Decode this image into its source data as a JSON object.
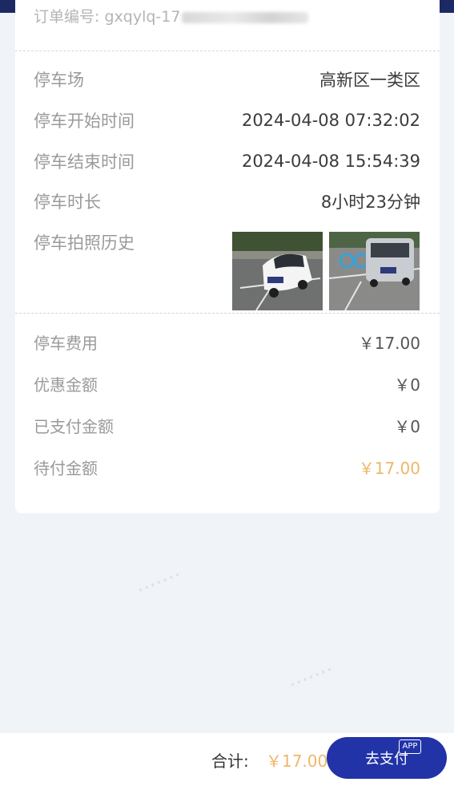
{
  "order": {
    "label": "订单编号:",
    "prefix": "gxqylq-17"
  },
  "details": {
    "parking_lot": {
      "label": "停车场",
      "value": "高新区一类区"
    },
    "start_time": {
      "label": "停车开始时间",
      "value": "2024-04-08 07:32:02"
    },
    "end_time": {
      "label": "停车结束时间",
      "value": "2024-04-08 15:54:39"
    },
    "duration": {
      "label": "停车时长",
      "value": "8小时23分钟"
    },
    "photo_history": {
      "label": "停车拍照历史"
    }
  },
  "fees": {
    "parking_fee": {
      "label": "停车费用",
      "value": "￥17.00"
    },
    "discount": {
      "label": "优惠金额",
      "value": "￥0"
    },
    "paid": {
      "label": "已支付金额",
      "value": "￥0"
    },
    "pending": {
      "label": "待付金额",
      "value": "￥17.00"
    }
  },
  "footer": {
    "total_label": "合计:",
    "total_value": "￥17.00",
    "pay_button": "去支付"
  },
  "colors": {
    "header": "#1b2a63",
    "accent_orange": "#f0b66a",
    "button": "#2233a8"
  }
}
